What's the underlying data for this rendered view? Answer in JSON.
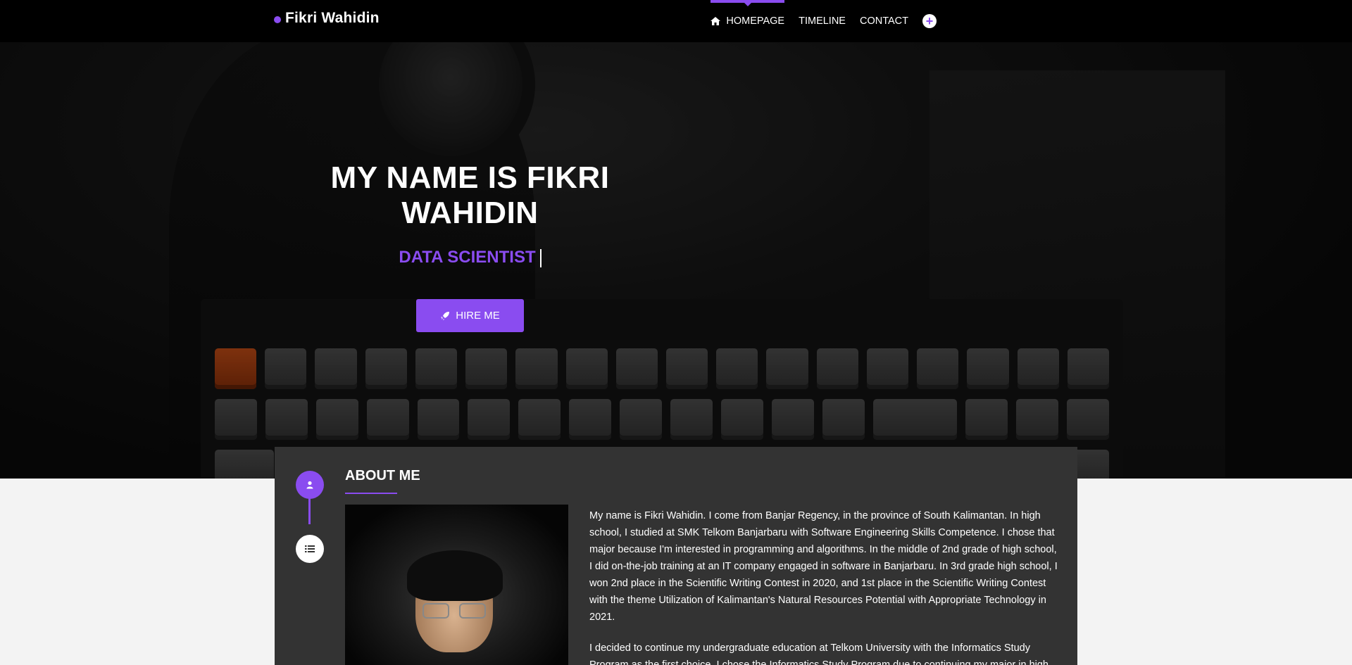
{
  "brand": {
    "name": "Fikri Wahidin"
  },
  "nav": {
    "items": [
      {
        "label": "HOMEPAGE",
        "icon": "home-icon",
        "active": true
      },
      {
        "label": "TIMELINE"
      },
      {
        "label": "CONTACT"
      }
    ],
    "extra_icon": "plus-circle-icon"
  },
  "hero": {
    "title": "MY NAME IS FIKRI WAHIDIN",
    "subtitle": "DATA SCIENTIST",
    "button_label": "HIRE ME",
    "button_icon": "rocket-icon"
  },
  "about": {
    "title": "ABOUT ME",
    "paragraphs": [
      "My name is Fikri Wahidin. I come from Banjar Regency, in the province of South Kalimantan. In high school, I studied at SMK Telkom Banjarbaru with Software Engineering Skills Competence. I chose that major because I'm interested in programming and algorithms. In the middle of 2nd grade of high school, I did on-the-job training at an IT company engaged in software in Banjarbaru. In 3rd grade high school, I won 2nd place in the Scientific Writing Contest in 2020, and 1st place in the Scientific Writing Contest with the theme Utilization of Kalimantan's Natural Resources Potential with Appropriate Technology in 2021.",
      "I decided to continue my undergraduate education at Telkom University with the Informatics Study Program as the first choice. I chose the Informatics Study Program due to continuing my major in high"
    ],
    "timeline_icons": [
      "user-icon",
      "list-icon"
    ]
  },
  "colors": {
    "accent": "#8a4cf0",
    "nav_bg": "#000000",
    "card_bg": "#333333",
    "page_bg": "#f3f3f3"
  }
}
